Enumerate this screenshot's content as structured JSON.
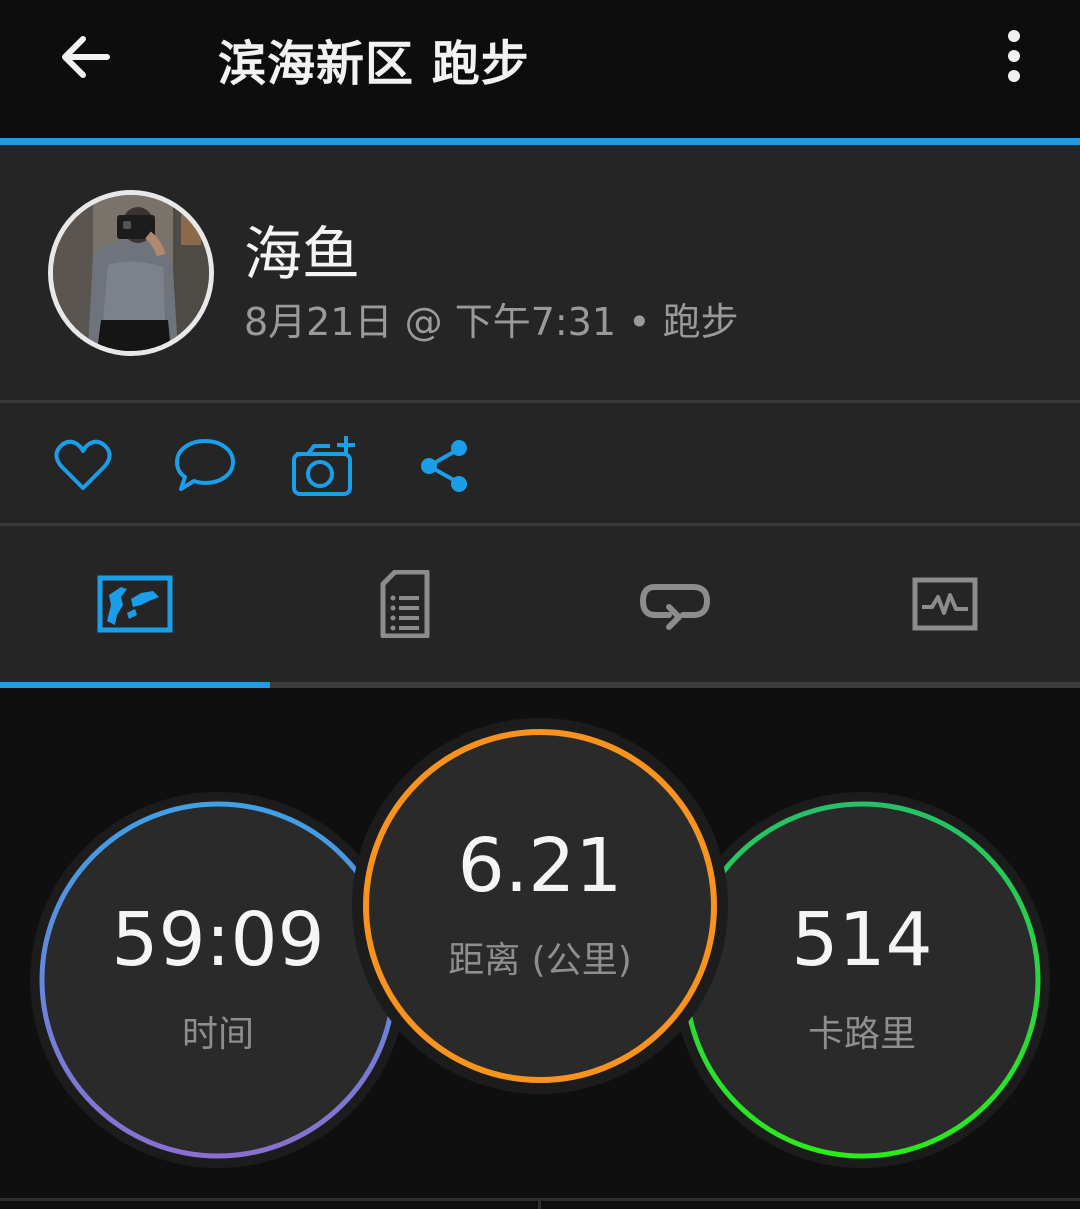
{
  "header": {
    "title": "滨海新区 跑步",
    "back_icon": "arrow-left-icon",
    "more_icon": "more-vertical-icon"
  },
  "profile": {
    "name": "海鱼",
    "meta": "8月21日 @ 下午7:31 • 跑步"
  },
  "actions": [
    {
      "icon": "heart-icon"
    },
    {
      "icon": "comment-icon"
    },
    {
      "icon": "add-photo-icon"
    },
    {
      "icon": "share-icon"
    }
  ],
  "tabs": {
    "active_index": 0,
    "items": [
      {
        "icon": "map-icon"
      },
      {
        "icon": "details-icon"
      },
      {
        "icon": "laps-icon"
      },
      {
        "icon": "charts-icon"
      }
    ]
  },
  "stats": {
    "time": {
      "value": "59:09",
      "label": "时间"
    },
    "distance": {
      "value": "6.21",
      "label": "距离 (公里)"
    },
    "calories": {
      "value": "514",
      "label": "卡路里"
    }
  },
  "colors": {
    "accent": "#1a9ee8",
    "time_ring_top": "#3fa0e6",
    "time_ring_bottom": "#8a6fd0",
    "distance_ring": "#f7931e",
    "calories_ring_top": "#27c06a",
    "calories_ring_bottom": "#2bea1a",
    "inactive_icon": "#8c8c8c"
  }
}
